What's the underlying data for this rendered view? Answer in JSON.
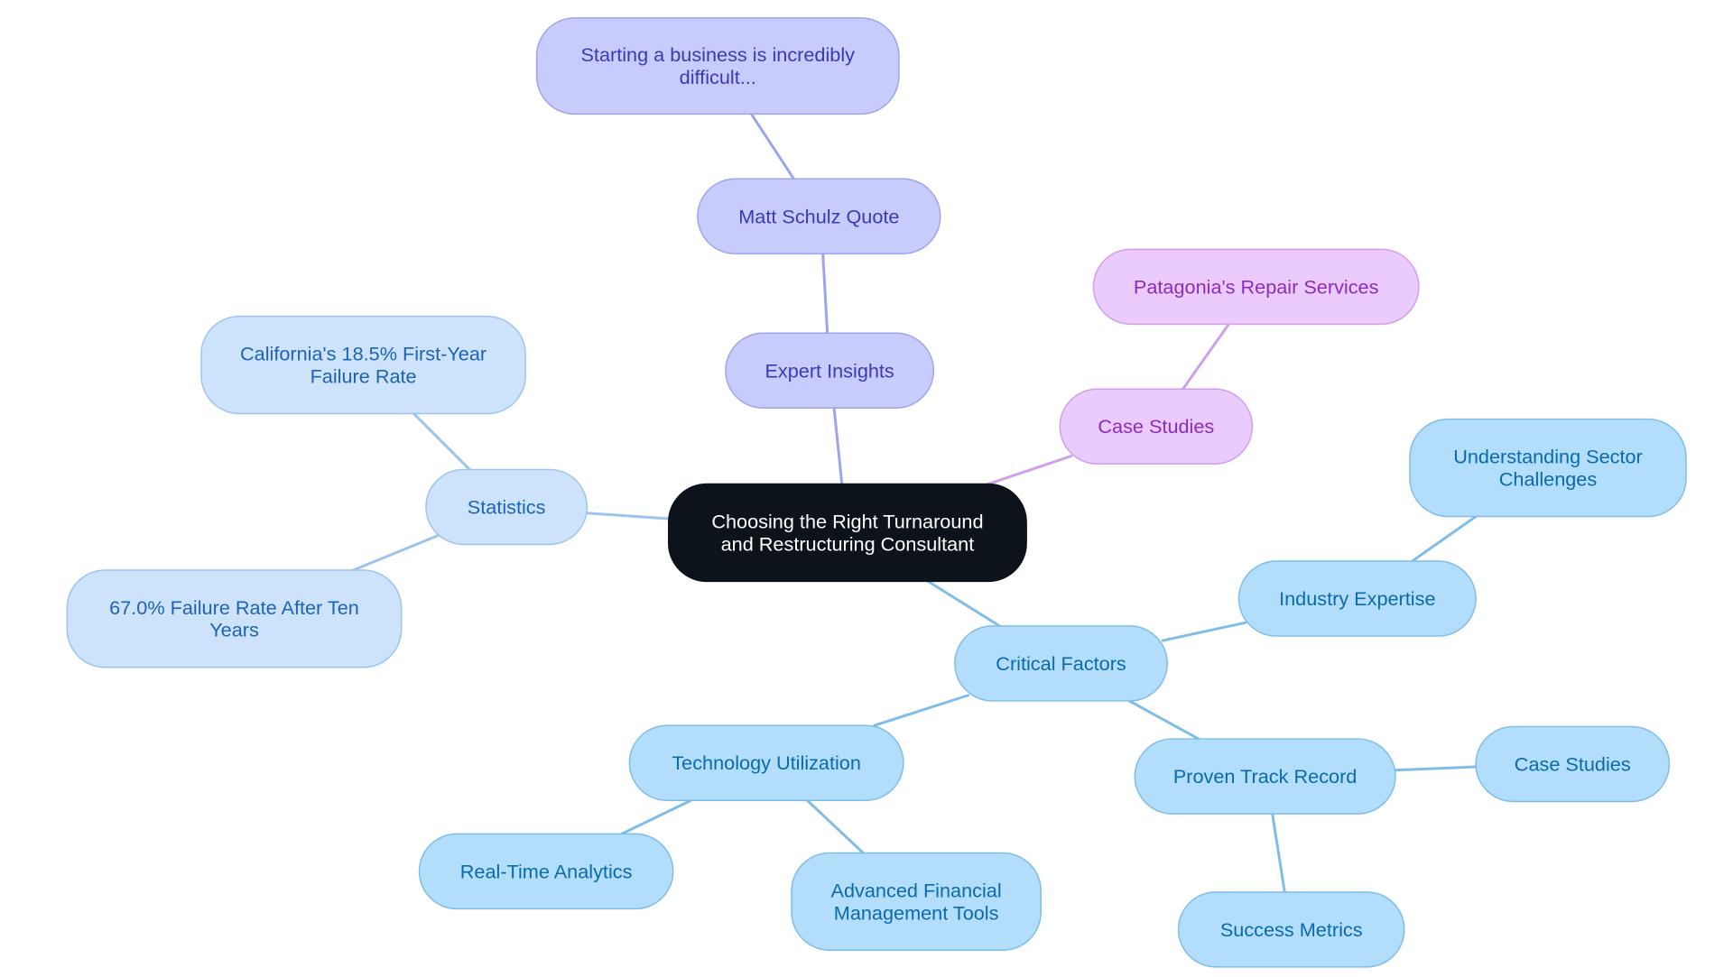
{
  "diagram": {
    "type": "mindmap",
    "title": "Choosing the Right Turnaround and Restructuring Consultant",
    "colors": {
      "root": {
        "fill": "#0c131a",
        "stroke": "#0c131a",
        "text": "#ffffff"
      },
      "statistics": {
        "fill": "#cde3fb",
        "stroke": "#9cc4ee",
        "text": "#1c63b8",
        "edge": "#9cc4ee"
      },
      "expert": {
        "fill": "#c8ccfd",
        "stroke": "#9ea4ec",
        "text": "#3a3ab8",
        "edge": "#9ea4ec"
      },
      "cases": {
        "fill": "#ebcafd",
        "stroke": "#cf9eec",
        "text": "#8a2cc0",
        "edge": "#cf9eec"
      },
      "critical": {
        "fill": "#b2defc",
        "stroke": "#7fbde8",
        "text": "#0b6aad",
        "edge": "#7fbde8"
      }
    },
    "nodes": [
      {
        "id": "root",
        "branch": "root",
        "lines": [
          "Choosing the Right Turnaround",
          "and Restructuring Consultant"
        ]
      },
      {
        "id": "statistics",
        "branch": "statistics",
        "parent": "root",
        "lines": [
          "Statistics"
        ]
      },
      {
        "id": "california",
        "branch": "statistics",
        "parent": "statistics",
        "lines": [
          "California's 18.5% First-Year",
          "Failure Rate"
        ]
      },
      {
        "id": "failure67",
        "branch": "statistics",
        "parent": "statistics",
        "lines": [
          "67.0% Failure Rate After Ten",
          "Years"
        ]
      },
      {
        "id": "expert",
        "branch": "expert",
        "parent": "root",
        "lines": [
          "Expert Insights"
        ]
      },
      {
        "id": "schulz",
        "branch": "expert",
        "parent": "expert",
        "lines": [
          "Matt Schulz Quote"
        ]
      },
      {
        "id": "quote",
        "branch": "expert",
        "parent": "schulz",
        "lines": [
          "Starting a business is incredibly",
          "difficult..."
        ]
      },
      {
        "id": "cases",
        "branch": "cases",
        "parent": "root",
        "lines": [
          "Case Studies"
        ]
      },
      {
        "id": "patagonia",
        "branch": "cases",
        "parent": "cases",
        "lines": [
          "Patagonia's Repair Services"
        ]
      },
      {
        "id": "critical",
        "branch": "critical",
        "parent": "root",
        "lines": [
          "Critical Factors"
        ]
      },
      {
        "id": "industry",
        "branch": "critical",
        "parent": "critical",
        "lines": [
          "Industry Expertise"
        ]
      },
      {
        "id": "sector",
        "branch": "critical",
        "parent": "industry",
        "lines": [
          "Understanding Sector",
          "Challenges"
        ]
      },
      {
        "id": "tech",
        "branch": "critical",
        "parent": "critical",
        "lines": [
          "Technology Utilization"
        ]
      },
      {
        "id": "realtime",
        "branch": "critical",
        "parent": "tech",
        "lines": [
          "Real-Time Analytics"
        ]
      },
      {
        "id": "advanced",
        "branch": "critical",
        "parent": "tech",
        "lines": [
          "Advanced Financial",
          "Management Tools"
        ]
      },
      {
        "id": "proven",
        "branch": "critical",
        "parent": "critical",
        "lines": [
          "Proven Track Record"
        ]
      },
      {
        "id": "cases2",
        "branch": "critical",
        "parent": "proven",
        "lines": [
          "Case Studies"
        ]
      },
      {
        "id": "success",
        "branch": "critical",
        "parent": "proven",
        "lines": [
          "Success Metrics"
        ]
      }
    ]
  }
}
